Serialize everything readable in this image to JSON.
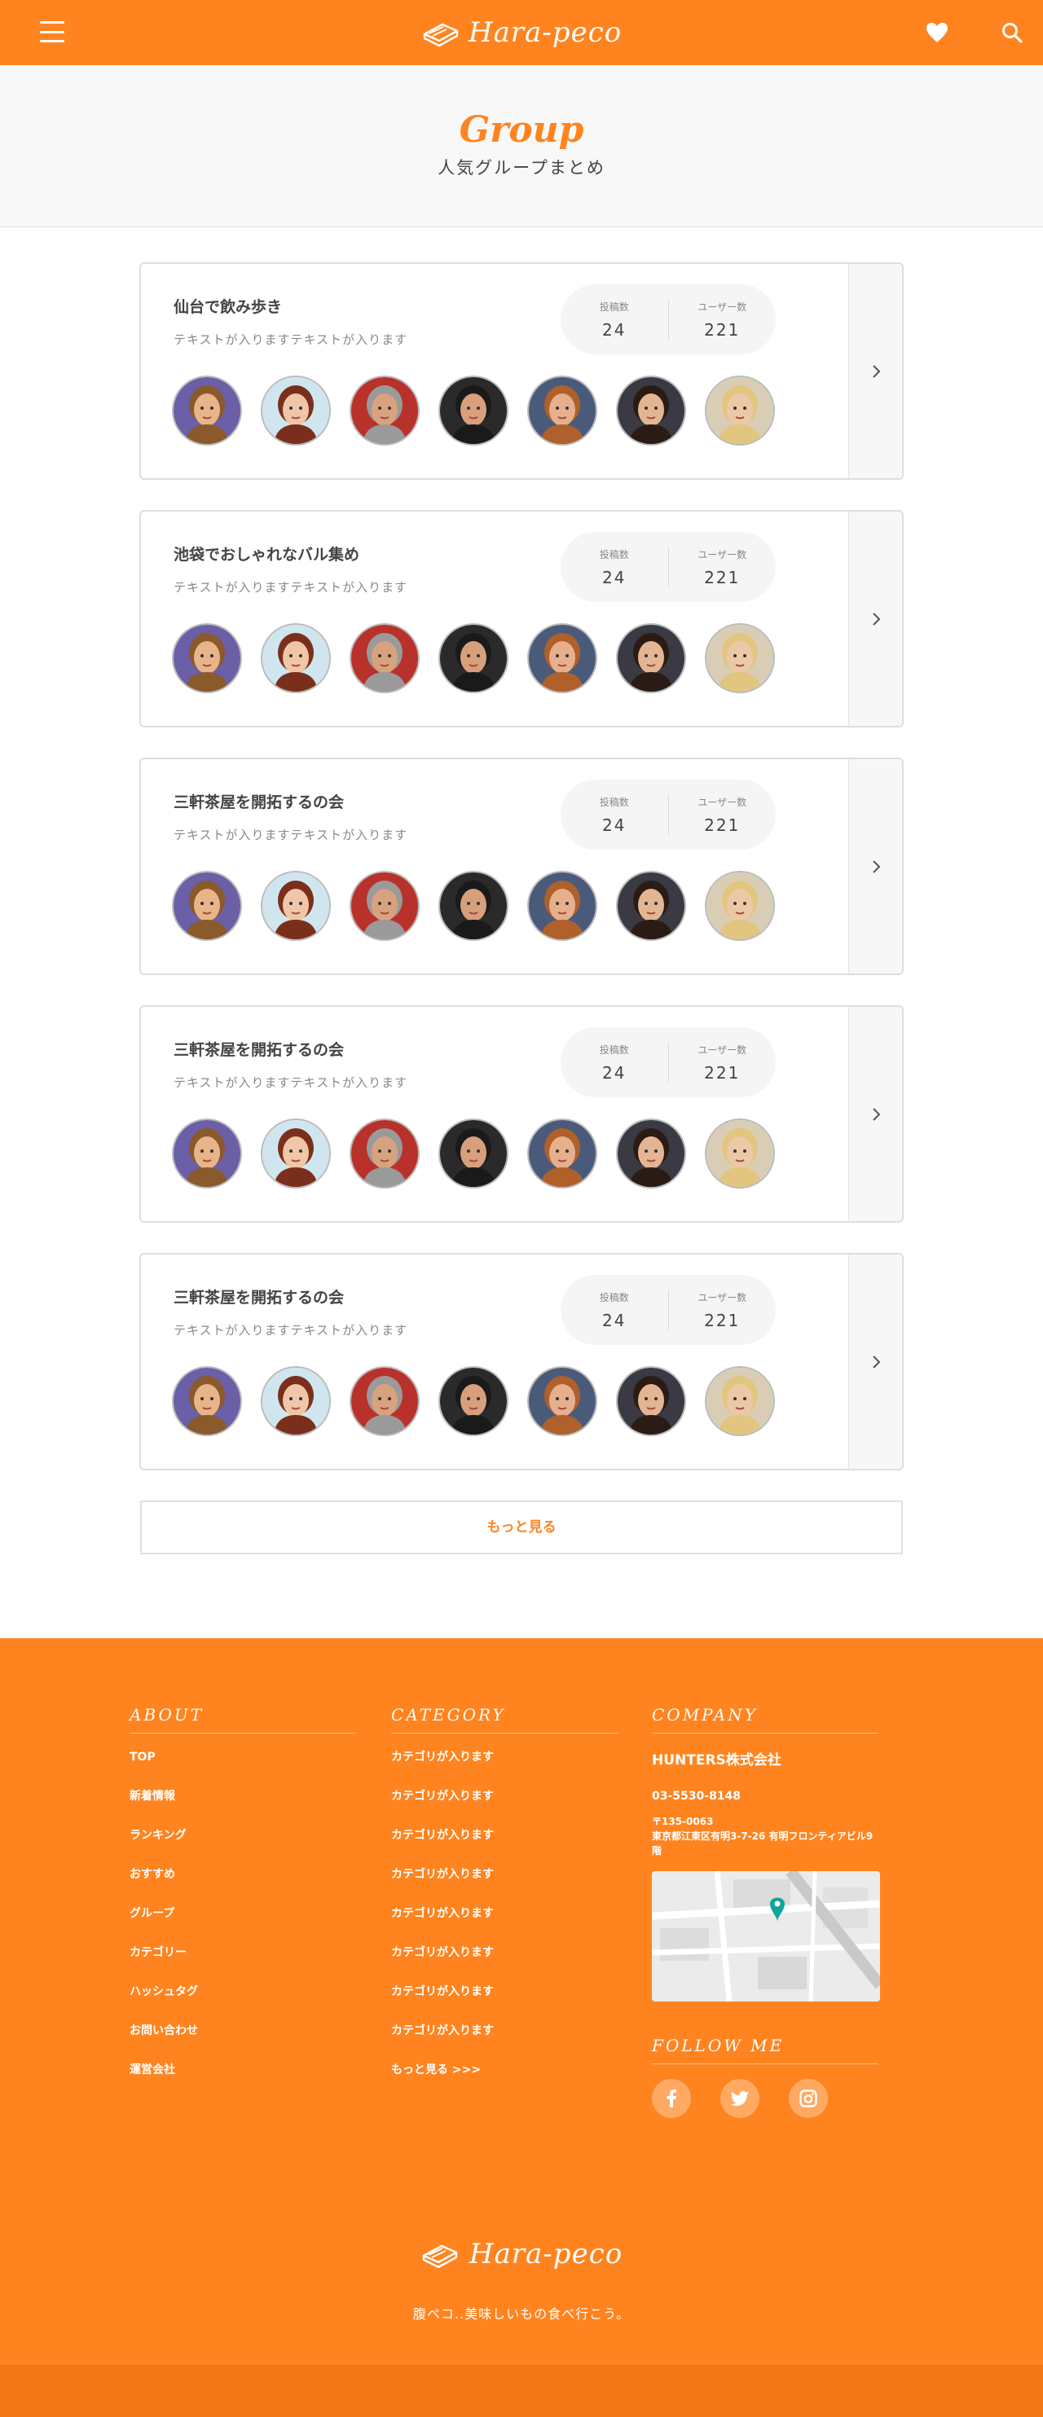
{
  "header": {
    "logo_text": "Hara-peco",
    "menu_icon": "hamburger-menu-icon",
    "favorite_icon": "heart-icon",
    "search_icon": "search-icon"
  },
  "hero": {
    "title": "Group",
    "subtitle": "人気グループまとめ"
  },
  "groups": [
    {
      "title": "仙台で飲み歩き",
      "description": "テキストが入りますテキストが入ります",
      "posts_label": "投稿数",
      "posts": "24",
      "users_label": "ユーザー数",
      "users": "221"
    },
    {
      "title": "池袋でおしゃれなバル集め",
      "description": "テキストが入りますテキストが入ります",
      "posts_label": "投稿数",
      "posts": "24",
      "users_label": "ユーザー数",
      "users": "221"
    },
    {
      "title": "三軒茶屋を開拓するの会",
      "description": "テキストが入りますテキストが入ります",
      "posts_label": "投稿数",
      "posts": "24",
      "users_label": "ユーザー数",
      "users": "221"
    },
    {
      "title": "三軒茶屋を開拓するの会",
      "description": "テキストが入りますテキストが入ります",
      "posts_label": "投稿数",
      "posts": "24",
      "users_label": "ユーザー数",
      "users": "221"
    },
    {
      "title": "三軒茶屋を開拓するの会",
      "description": "テキストが入りますテキストが入ります",
      "posts_label": "投稿数",
      "posts": "24",
      "users_label": "ユーザー数",
      "users": "221"
    }
  ],
  "more_button": "もっと見る",
  "footer": {
    "about": {
      "heading": "ABOUT",
      "links": [
        "TOP",
        "新着情報",
        "ランキング",
        "おすすめ",
        "グループ",
        "カテゴリー",
        "ハッシュタグ",
        "お問い合わせ",
        "運営会社"
      ]
    },
    "category": {
      "heading": "CATEGORY",
      "links": [
        "カテゴリが入ります",
        "カテゴリが入ります",
        "カテゴリが入ります",
        "カテゴリが入ります",
        "カテゴリが入ります",
        "カテゴリが入ります",
        "カテゴリが入ります",
        "カテゴリが入ります",
        "もっと見る >>>"
      ]
    },
    "company": {
      "heading": "COMPANY",
      "name": "HUNTERS株式会社",
      "tel": "03-5530-8148",
      "postal": "〒135-0063",
      "address": "東京都江東区有明3-7-26 有明フロンティアビル9階"
    },
    "follow": {
      "heading": "FOLLOW ME",
      "icons": [
        "facebook-icon",
        "twitter-icon",
        "instagram-icon"
      ]
    },
    "logo_text": "Hara-peco",
    "tagline": "腹ペコ..美味しいもの食べ行こう。"
  },
  "colors": {
    "brand": "#ff841f",
    "brand_dark": "#f27815"
  }
}
